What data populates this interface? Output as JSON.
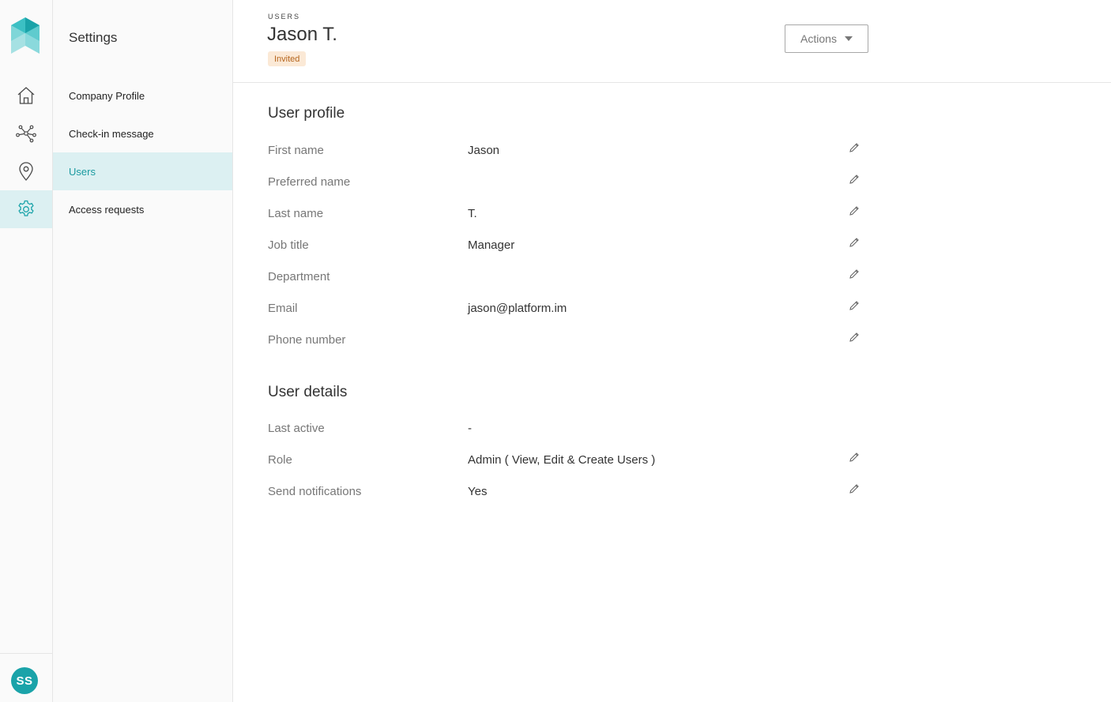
{
  "brand": {
    "accent": "#1aa3a9",
    "active_bg": "#dcf0f2",
    "badge_bg": "#fbe9d6",
    "badge_text": "#b5651d"
  },
  "rail": {
    "items": [
      {
        "icon": "home-icon"
      },
      {
        "icon": "network-icon"
      },
      {
        "icon": "location-pin-icon"
      },
      {
        "icon": "gear-icon",
        "active": true
      }
    ],
    "avatar_initials": "SS"
  },
  "sidebar": {
    "title": "Settings",
    "items": [
      {
        "label": "Company Profile"
      },
      {
        "label": "Check-in message"
      },
      {
        "label": "Users",
        "active": true
      },
      {
        "label": "Access requests"
      }
    ]
  },
  "header": {
    "eyebrow": "USERS",
    "title": "Jason T.",
    "status_badge": "Invited",
    "actions_label": "Actions"
  },
  "profile": {
    "title": "User profile",
    "fields": [
      {
        "label": "First name",
        "value": "Jason",
        "editable": true
      },
      {
        "label": "Preferred name",
        "value": "",
        "editable": true
      },
      {
        "label": "Last name",
        "value": "T.",
        "editable": true
      },
      {
        "label": "Job title",
        "value": "Manager",
        "editable": true
      },
      {
        "label": "Department",
        "value": "",
        "editable": true
      },
      {
        "label": "Email",
        "value": "jason@platform.im",
        "editable": true
      },
      {
        "label": "Phone number",
        "value": "",
        "editable": true
      }
    ]
  },
  "details": {
    "title": "User details",
    "fields": [
      {
        "label": "Last active",
        "value": "-",
        "editable": false
      },
      {
        "label": "Role",
        "value": "Admin ( View, Edit & Create Users )",
        "editable": true
      },
      {
        "label": "Send notifications",
        "value": "Yes",
        "editable": true
      }
    ]
  }
}
